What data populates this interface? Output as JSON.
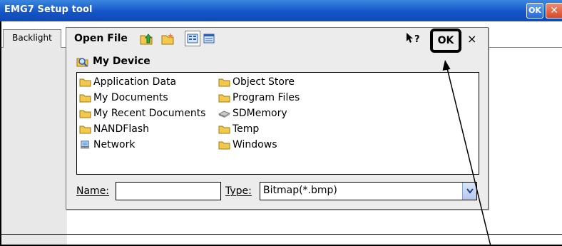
{
  "window": {
    "title": "EMG7 Setup tool",
    "ok_label": "OK",
    "close_label": "✕"
  },
  "tabs": [
    {
      "label": "Backlight"
    }
  ],
  "dialog": {
    "title": "Open File",
    "ok_label": "OK",
    "close_label": "×",
    "help_label": "?",
    "location": "My Device",
    "items": [
      {
        "label": "Application Data",
        "icon": "folder-icon"
      },
      {
        "label": "My Documents",
        "icon": "folder-icon"
      },
      {
        "label": "My Recent Documents",
        "icon": "folder-icon"
      },
      {
        "label": "NANDFlash",
        "icon": "folder-icon"
      },
      {
        "label": "Network",
        "icon": "network-icon"
      },
      {
        "label": "Object Store",
        "icon": "folder-icon"
      },
      {
        "label": "Program Files",
        "icon": "folder-icon"
      },
      {
        "label": "SDMemory",
        "icon": "storage-card-icon"
      },
      {
        "label": "Temp",
        "icon": "folder-icon"
      },
      {
        "label": "Windows",
        "icon": "folder-icon"
      }
    ],
    "name_label": "Name:",
    "name_value": "",
    "type_label": "Type:",
    "type_value": "Bitmap(*.bmp)"
  },
  "colors": {
    "titlebar": "#1555c8",
    "folder": "#f2c94c",
    "dialog_bg": "#ececec"
  }
}
